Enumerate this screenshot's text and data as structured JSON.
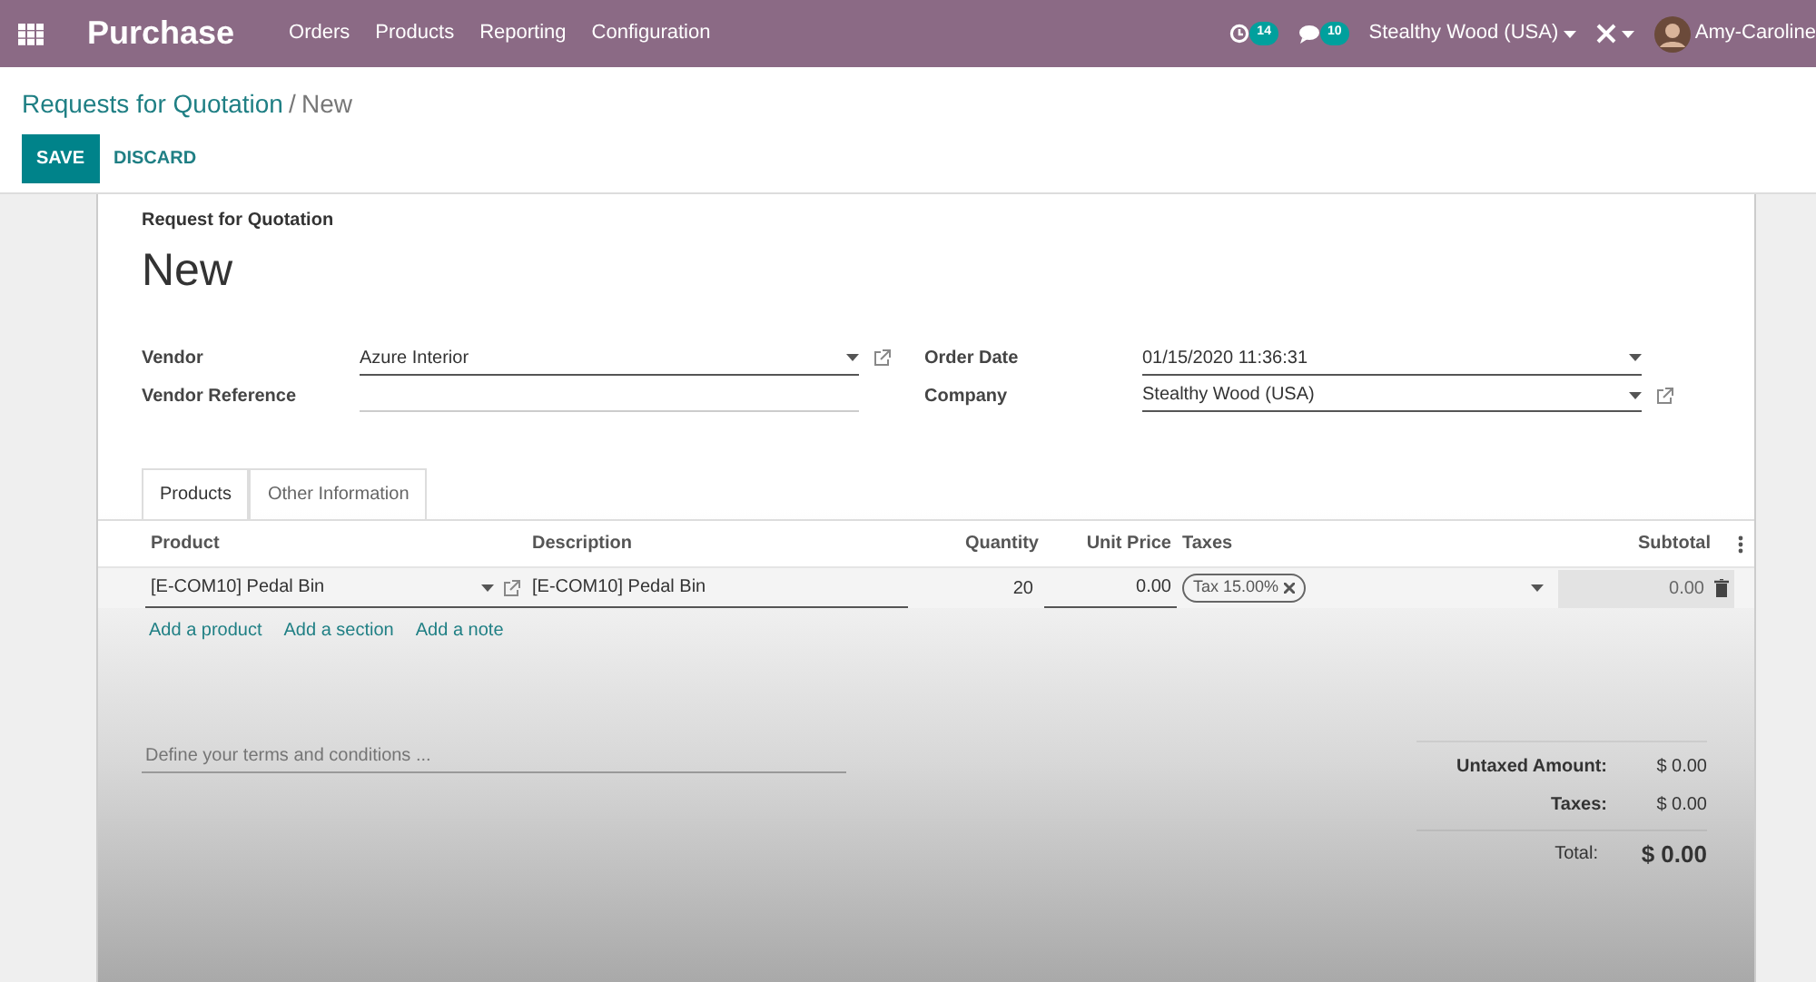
{
  "navbar": {
    "app_name": "Purchase",
    "menu": [
      "Orders",
      "Products",
      "Reporting",
      "Configuration"
    ],
    "activity_count": "14",
    "message_count": "10",
    "company": "Stealthy Wood (USA)",
    "user": "Amy-Caroline"
  },
  "breadcrumb": {
    "parent": "Requests for Quotation",
    "separator": "/",
    "current": "New"
  },
  "buttons": [
    {
      "label": "SAVE",
      "kind": "primary"
    },
    {
      "label": "DISCARD",
      "kind": "link"
    }
  ],
  "form": {
    "subtitle": "Request for Quotation",
    "title": "New",
    "left_fields": [
      {
        "label": "Vendor",
        "value": "Azure Interior",
        "dropdown": true,
        "external_link": true
      },
      {
        "label": "Vendor Reference",
        "dropdown": false,
        "external_link": false
      }
    ],
    "right_fields": [
      {
        "label": "Order Date",
        "value": "01/15/2020 11:36:31",
        "dropdown": true,
        "external_link": false
      },
      {
        "label": "Company",
        "value": "Stealthy Wood (USA)",
        "dropdown": true,
        "external_link": true
      }
    ],
    "tabs": [
      {
        "label": "Products",
        "selected": true
      },
      {
        "label": "Other Information",
        "selected": false
      }
    ],
    "table": {
      "columns": [
        "Product",
        "Description",
        "Quantity",
        "Unit Price",
        "Taxes",
        "Subtotal"
      ],
      "rows": [
        {
          "product": "[E-COM10] Pedal Bin",
          "description": "[E-COM10] Pedal Bin",
          "quantity": "20",
          "unit_price": "0.00",
          "taxes": [
            "Tax 15.00%"
          ],
          "subtotal": "0.00"
        }
      ],
      "add_links": [
        "Add a product",
        "Add a section",
        "Add a note"
      ]
    },
    "terms": {
      "placeholder": "Define your terms and conditions ..."
    },
    "totals": [
      {
        "label": "Untaxed Amount:",
        "value": "$ 0.00",
        "kind": "line"
      },
      {
        "label": "Taxes:",
        "value": "$ 0.00",
        "kind": "line"
      },
      {
        "label": "Total:",
        "value": "$ 0.00",
        "kind": "total"
      }
    ]
  }
}
